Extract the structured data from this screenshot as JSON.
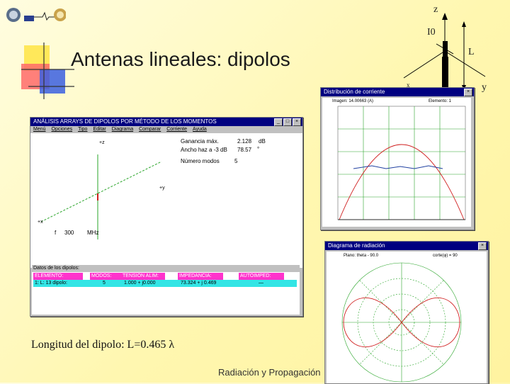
{
  "slide": {
    "title": "Antenas lineales: dipolos",
    "caption": "Longitud del dipolo: L=0.465 λ",
    "footer": "Radiación y Propagación"
  },
  "diagram": {
    "z_label": "z",
    "current_label": "I0",
    "length_label": "L",
    "x_label": "x",
    "y_label": "y"
  },
  "arrays_window": {
    "title": "ANÁLISIS ARRAYS DE DIPOLOS POR MÉTODO DE LOS MOMENTOS",
    "menu": [
      "Menú",
      "Opciones",
      "Tipo",
      "Editar",
      "Diagrama",
      "Comparar",
      "Corriente",
      "Ayuda"
    ],
    "axis_z": "+z",
    "axis_y": "+y",
    "axis_x": "+x",
    "gain_label": "Ganancia máx.",
    "gain_value": "2.128",
    "gain_unit": "dB",
    "beam_label": "Ancho haz a -3 dB",
    "beam_value": "78.57",
    "beam_unit": "°",
    "modes_label": "Número modos",
    "modes_value": "5",
    "freq_label": "f",
    "freq_value": "300",
    "freq_unit": "MHz",
    "table_title": "Datos de los dipolos:",
    "headers": [
      "ELEMENTO:",
      "MODOS:",
      "TENSIÓN ALIM:",
      "IMPEDANCIA:",
      "AUTOIMPED:"
    ],
    "row": [
      "1: L: 13 dipolo:",
      "5",
      "1.000 + j0.000",
      "73.324 + j 0.469",
      "—"
    ]
  },
  "current_window": {
    "title": "Distribución de corriente",
    "left_header": "Imagen: 14.00663 (A)",
    "right_header": "Elemento: 1"
  },
  "pattern_window": {
    "title": "Diagrama de radiación",
    "left_header": "Plano: theta - 90.0",
    "right_header": "corte(φ) = 90"
  }
}
